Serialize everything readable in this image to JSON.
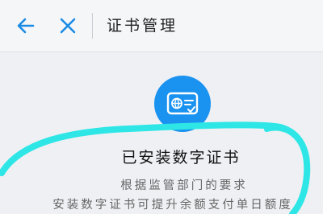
{
  "navbar": {
    "title": "证书管理",
    "back_icon": "arrow-left-icon",
    "close_icon": "close-icon",
    "icon_color": "#1a8be5"
  },
  "certificate": {
    "icon": "certificate-card-icon",
    "icon_color": "#1a92f0",
    "status": "已安装数字证书",
    "description_line1": "根据监管部门的要求",
    "description_line2": "安装数字证书可提升余额支付单日额度"
  },
  "annotation_color": "#2ee6e6"
}
